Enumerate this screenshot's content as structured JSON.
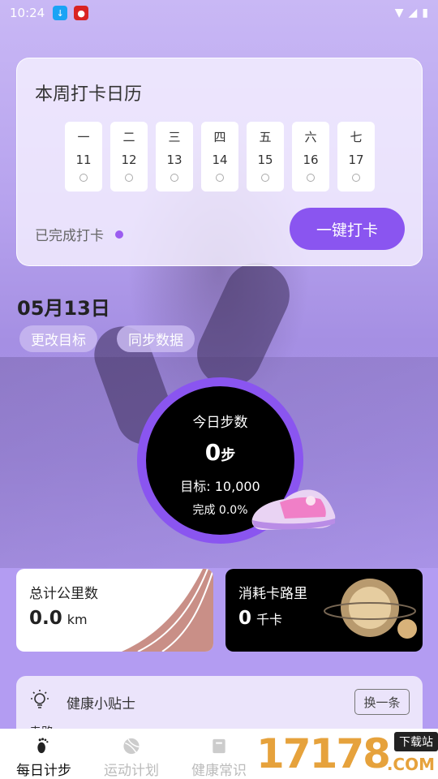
{
  "status_bar": {
    "time": "10:24"
  },
  "calendar": {
    "title": "本周打卡日历",
    "days": [
      {
        "weekday": "一",
        "date": "11"
      },
      {
        "weekday": "二",
        "date": "12"
      },
      {
        "weekday": "三",
        "date": "13"
      },
      {
        "weekday": "四",
        "date": "14"
      },
      {
        "weekday": "五",
        "date": "15"
      },
      {
        "weekday": "六",
        "date": "16"
      },
      {
        "weekday": "七",
        "date": "17"
      }
    ],
    "done_label": "已完成打卡",
    "checkin_button": "一键打卡"
  },
  "today": {
    "date": "05月13日",
    "change_goal": "更改目标",
    "sync_data": "同步数据"
  },
  "steps": {
    "label": "今日步数",
    "value": "0",
    "unit": "步",
    "goal": "目标: 10,000",
    "progress": "完成 0.0%"
  },
  "stats": {
    "distance": {
      "title": "总计公里数",
      "value": "0.0",
      "unit": "km"
    },
    "calories": {
      "title": "消耗卡路里",
      "value": "0",
      "unit": "千卡"
    }
  },
  "tips": {
    "title": "健康小贴士",
    "change_button": "换一条",
    "text": "走路…………"
  },
  "tabs": [
    {
      "label": "每日计步",
      "icon": "footprint-icon"
    },
    {
      "label": "运动计划",
      "icon": "ball-icon"
    },
    {
      "label": "健康常识",
      "icon": "book-icon"
    },
    {
      "label": "",
      "icon": ""
    },
    {
      "label": "",
      "icon": ""
    }
  ],
  "watermark": {
    "brand": "17178",
    "badge": "下载站",
    "suffix": ".COM"
  },
  "colors": {
    "accent": "#8a55f0",
    "background": "#b39cf2"
  }
}
